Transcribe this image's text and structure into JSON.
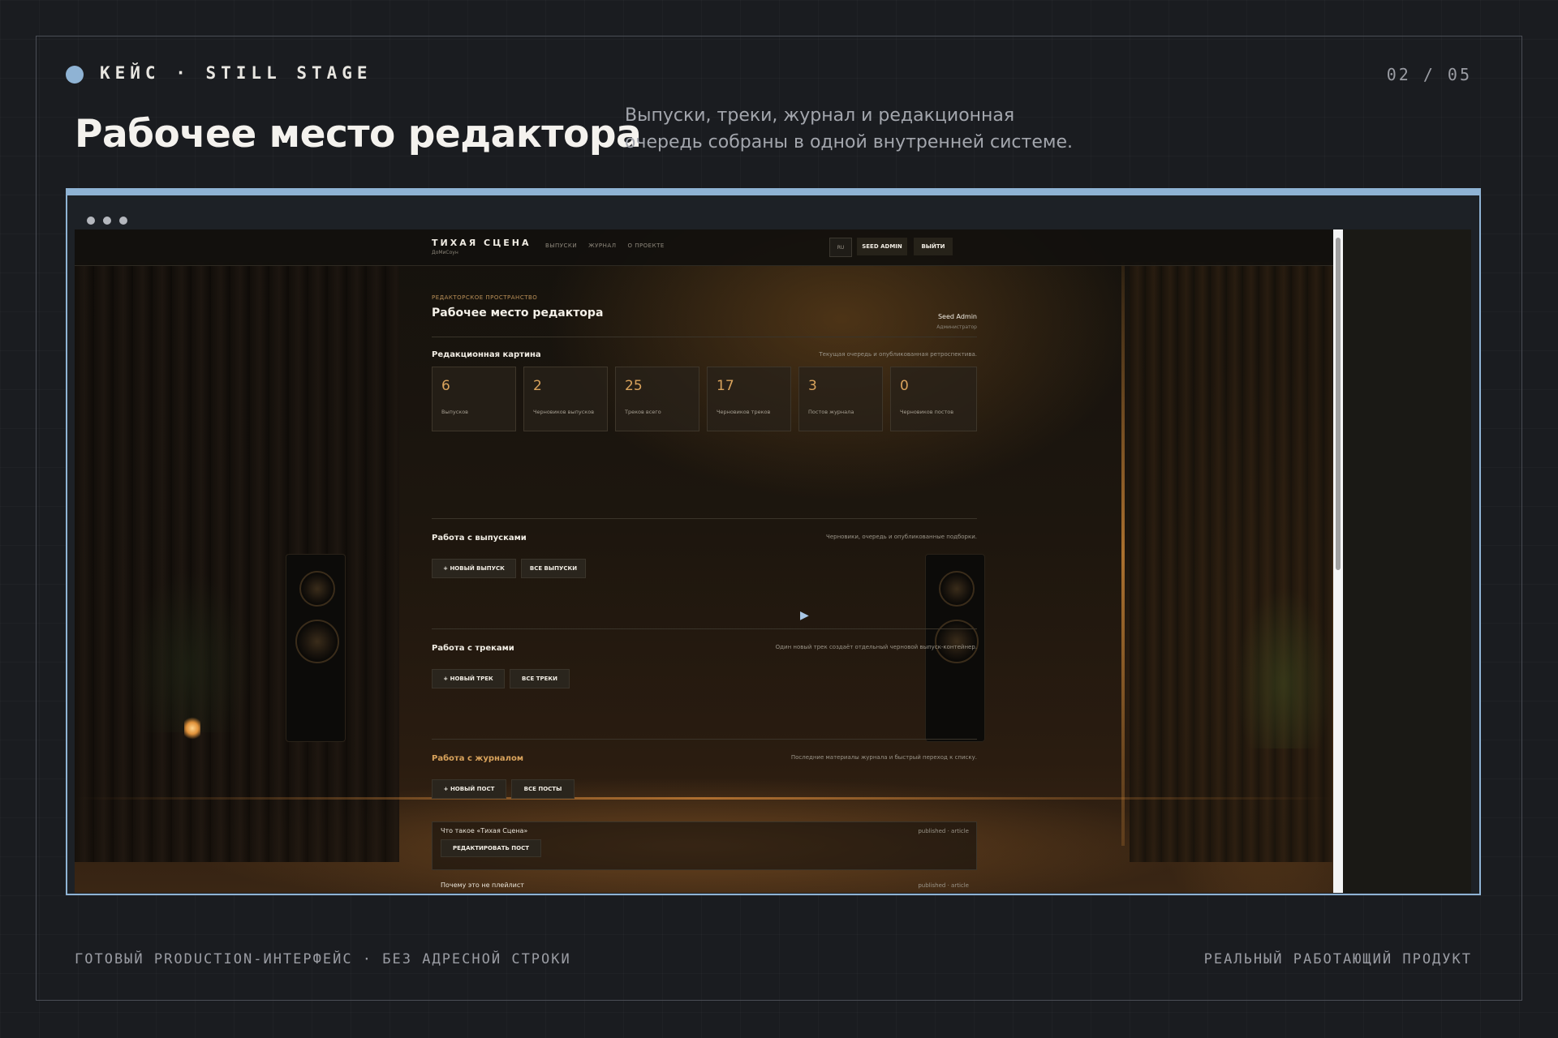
{
  "slide": {
    "case_label": "КЕЙС · STILL STAGE",
    "counter": "02 / 05",
    "title": "Рабочее место редактора",
    "subtitle": "Выпуски, треки, журнал и редакционная очередь собраны в одной внутренней системе.",
    "footer_left": "ГОТОВЫЙ PRODUCTION-ИНТЕРФЕЙС · БЕЗ АДРЕСНОЙ СТРОКИ",
    "footer_right": "РЕАЛЬНЫЙ РАБОТАЮЩИЙ ПРОДУКТ",
    "accent_color": "#8fb3d4"
  },
  "app": {
    "brand": "ТИХАЯ СЦЕНА",
    "brand_sub": "ДоМиСоун",
    "nav": [
      "ВЫПУСКИ",
      "ЖУРНАЛ",
      "О ПРОЕКТЕ"
    ],
    "lang": "RU",
    "user_button": "SEED ADMIN",
    "logout_button": "ВЫЙТИ",
    "eyebrow": "РЕДАКТОРСКОЕ ПРОСТРАНСТВО",
    "page_title": "Рабочее место редактора",
    "user_name": "Seed Admin",
    "user_role": "Администратор",
    "overview": {
      "title": "Редакционная картина",
      "desc": "Текущая очередь и опубликованная ретроспектива.",
      "stats": [
        {
          "value": "6",
          "label": "Выпусков"
        },
        {
          "value": "2",
          "label": "Черновиков выпусков"
        },
        {
          "value": "25",
          "label": "Треков всего"
        },
        {
          "value": "17",
          "label": "Черновиков треков"
        },
        {
          "value": "3",
          "label": "Постов журнала"
        },
        {
          "value": "0",
          "label": "Черновиков постов"
        }
      ]
    },
    "releases": {
      "title": "Работа с выпусками",
      "desc": "Черновики, очередь и опубликованные подборки.",
      "buttons": [
        "+ НОВЫЙ ВЫПУСК",
        "ВСЕ ВЫПУСКИ"
      ]
    },
    "tracks": {
      "title": "Работа с треками",
      "desc": "Один новый трек создаёт отдельный черновой выпуск-контейнер.",
      "buttons": [
        "+ НОВЫЙ ТРЕК",
        "ВСЕ ТРЕКИ"
      ]
    },
    "journal": {
      "title": "Работа с журналом",
      "desc": "Последние материалы журнала и быстрый переход к списку.",
      "buttons": [
        "+ НОВЫЙ ПОСТ",
        "ВСЕ ПОСТЫ"
      ],
      "posts": [
        {
          "title": "Что такое «Тихая Сцена»",
          "meta": "published · article",
          "edit": "РЕДАКТИРОВАТЬ ПОСТ"
        },
        {
          "title": "Почему это не плейлист",
          "meta": "published · article"
        }
      ]
    },
    "highlight_color": "#d9a35c"
  }
}
